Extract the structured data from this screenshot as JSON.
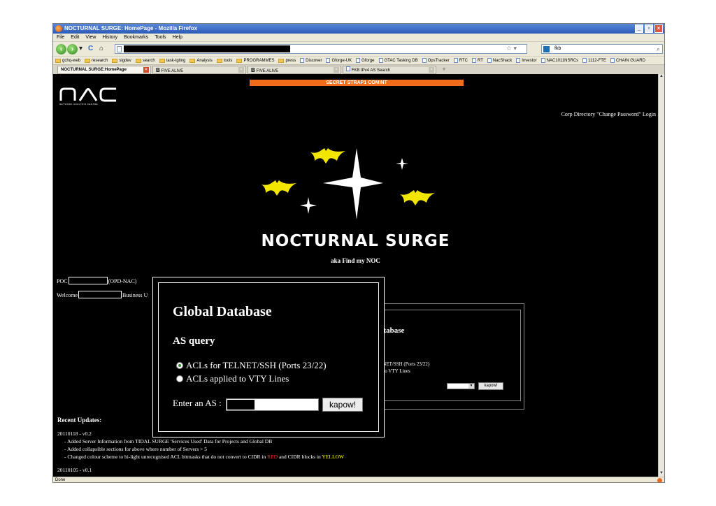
{
  "window": {
    "title": "NOCTURNAL SURGE: HomePage - Mozilla Firefox"
  },
  "menu": [
    "File",
    "Edit",
    "View",
    "History",
    "Bookmarks",
    "Tools",
    "Help"
  ],
  "search": {
    "value": "fkb"
  },
  "bookmarks": [
    {
      "label": "gchq-web",
      "icon": "folder"
    },
    {
      "label": "research",
      "icon": "folder"
    },
    {
      "label": "sigdev",
      "icon": "folder"
    },
    {
      "label": "search",
      "icon": "folder"
    },
    {
      "label": "task-tgting",
      "icon": "folder"
    },
    {
      "label": "Analysis",
      "icon": "folder"
    },
    {
      "label": "tools",
      "icon": "folder"
    },
    {
      "label": "PROGRAMMES",
      "icon": "folder"
    },
    {
      "label": "press",
      "icon": "folder"
    },
    {
      "label": "Discover",
      "icon": "page"
    },
    {
      "label": "Gforge-UK",
      "icon": "page"
    },
    {
      "label": "Gforge",
      "icon": "page"
    },
    {
      "label": "GTAC Tasking DB",
      "icon": "page"
    },
    {
      "label": "OpsTracker",
      "icon": "page"
    },
    {
      "label": "RTC",
      "icon": "page"
    },
    {
      "label": "RT",
      "icon": "page"
    },
    {
      "label": "NacShack",
      "icon": "page"
    },
    {
      "label": "Investor",
      "icon": "page"
    },
    {
      "label": "NAC1011NSRCs",
      "icon": "page"
    },
    {
      "label": "1112-FTE",
      "icon": "page"
    },
    {
      "label": "CHAIN GUARD",
      "icon": "page"
    }
  ],
  "tabs": [
    {
      "label": "NOCTURNAL SURGE:HomePage"
    },
    {
      "label": "FIVE ALIVE"
    },
    {
      "label": "FIVE ALIVE"
    },
    {
      "label": "FKB IPv4 AS Search"
    }
  ],
  "page": {
    "classification": "SECRET STRAP1 COMINT",
    "org_logo": "NAC",
    "org_sub": "NETWORK ANALYSIS CENTRE",
    "top_links": "Corp Directory \"Change Password\" Login",
    "brand": "NOCTURNAL SURGE",
    "aka": "aka Find my NOC",
    "poc_prefix": "POC",
    "poc_suffix": "(OPD-NAC)",
    "welcome_prefix": "Welcome",
    "welcome_suffix": "Business U",
    "bg_panel": {
      "title": "atabase",
      "subtitle": "y",
      "line1": "LNET/SSH (Ports 23/22)",
      "line2": "d to VTY Lines",
      "button": "kapow!"
    },
    "recent_updates_title": "Recent Updates:",
    "updates": [
      {
        "version": "20110118 - v0.2"
      },
      {
        "item": "- Added Server Information from TIDAL SURGE 'Services Used' Data for Projects and Global DB"
      },
      {
        "item": "- Added collapsible sections for above where number of Servers > 5"
      },
      {
        "item_pre": "- Changed colour scheme to hi-light unrecognised ACL bitmasks that do not convert to CIDR in ",
        "item_red": "RED",
        "item_mid": " and CIDR blocks in ",
        "item_yellow": "YELLOW"
      },
      {
        "version": "20110105 - v0.1"
      }
    ]
  },
  "popup": {
    "title": "Global Database",
    "subtitle": "AS query",
    "option1": "ACLs for TELNET/SSH (Ports 23/22)",
    "option2": "ACLs applied to VTY Lines",
    "as_label": "Enter an AS :",
    "button": "kapow!"
  },
  "status": {
    "text": "Done"
  },
  "colors": {
    "classification_bar": "#f26c1c",
    "bat": "#f2e600",
    "content_bg": "#000000"
  }
}
